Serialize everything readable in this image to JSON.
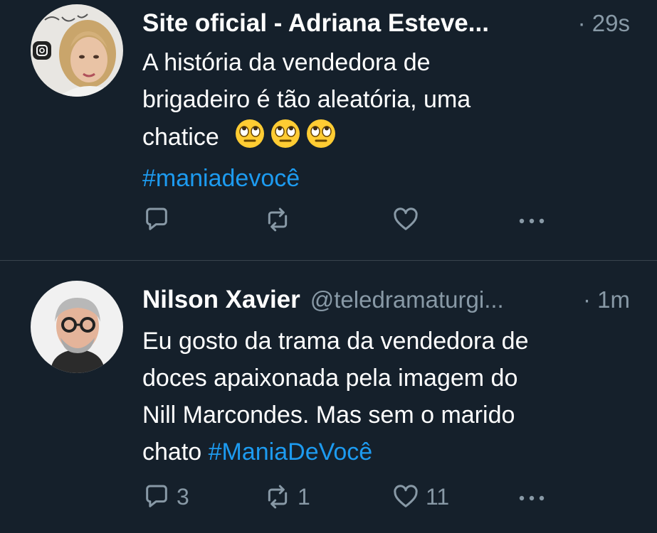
{
  "tweets": [
    {
      "name": "Site oficial - Adriana Esteve...",
      "handle": "",
      "time": "· 29s",
      "text_lines": [
        "A história da vendedora de",
        "brigadeiro é tão aleatória, uma",
        "chatice"
      ],
      "emoji_count": 3,
      "emoji_icon": "face-with-rolling-eyes",
      "hashtag": "#maniadevocê",
      "counts": {
        "reply": "",
        "retweet": "",
        "like": ""
      }
    },
    {
      "name": "Nilson Xavier",
      "handle": "@teledramaturgi...",
      "time": "· 1m",
      "text_lines": [
        "Eu gosto da trama da vendedora de",
        "doces apaixonada pela imagem do",
        "Nill Marcondes.  Mas sem o marido",
        "chato "
      ],
      "hashtag": "#ManiaDeVocê",
      "counts": {
        "reply": "3",
        "retweet": "1",
        "like": "11"
      }
    }
  ],
  "colors": {
    "background": "#15202b",
    "text": "#ffffff",
    "muted": "#8899a6",
    "link": "#1d9bf0",
    "divider": "#38444d"
  }
}
